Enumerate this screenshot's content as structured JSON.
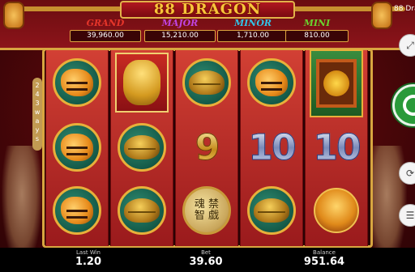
{
  "game": {
    "title": "88 DRAGON",
    "corner_title": "88 Drago",
    "ways_label": [
      "2",
      "4",
      "3",
      "w",
      "a",
      "y",
      "s"
    ]
  },
  "jackpots": [
    {
      "name": "GRAND",
      "value": "39,960.00",
      "color": "#e5352a"
    },
    {
      "name": "MAJOR",
      "value": "15,210.00",
      "color": "#c044e0"
    },
    {
      "name": "MINOR",
      "value": "1,710.00",
      "color": "#33c3e6"
    },
    {
      "name": "MINI",
      "value": "810.00",
      "color": "#6ad22e"
    }
  ],
  "reels": [
    [
      "tiger",
      "tiger",
      "tiger"
    ],
    [
      "golden-dragon",
      "turtle",
      "turtle"
    ],
    [
      "turtle",
      "9",
      "chinese-coin"
    ],
    [
      "tiger",
      "10",
      "turtle"
    ],
    [
      "gong",
      "10",
      "phoenix"
    ]
  ],
  "coin_text": "魂 禁\n智 戯",
  "bottom": {
    "last_win_label": "Last Win",
    "last_win": "1.20",
    "bet_label": "Bet",
    "bet": "39.60",
    "balance_label": "Balance",
    "balance": "951.64"
  },
  "icons": {
    "top_ctrl": "expand-icon",
    "spin": "spin-icon",
    "mid_ctrl": "autoplay-icon",
    "menu": "menu-icon"
  }
}
